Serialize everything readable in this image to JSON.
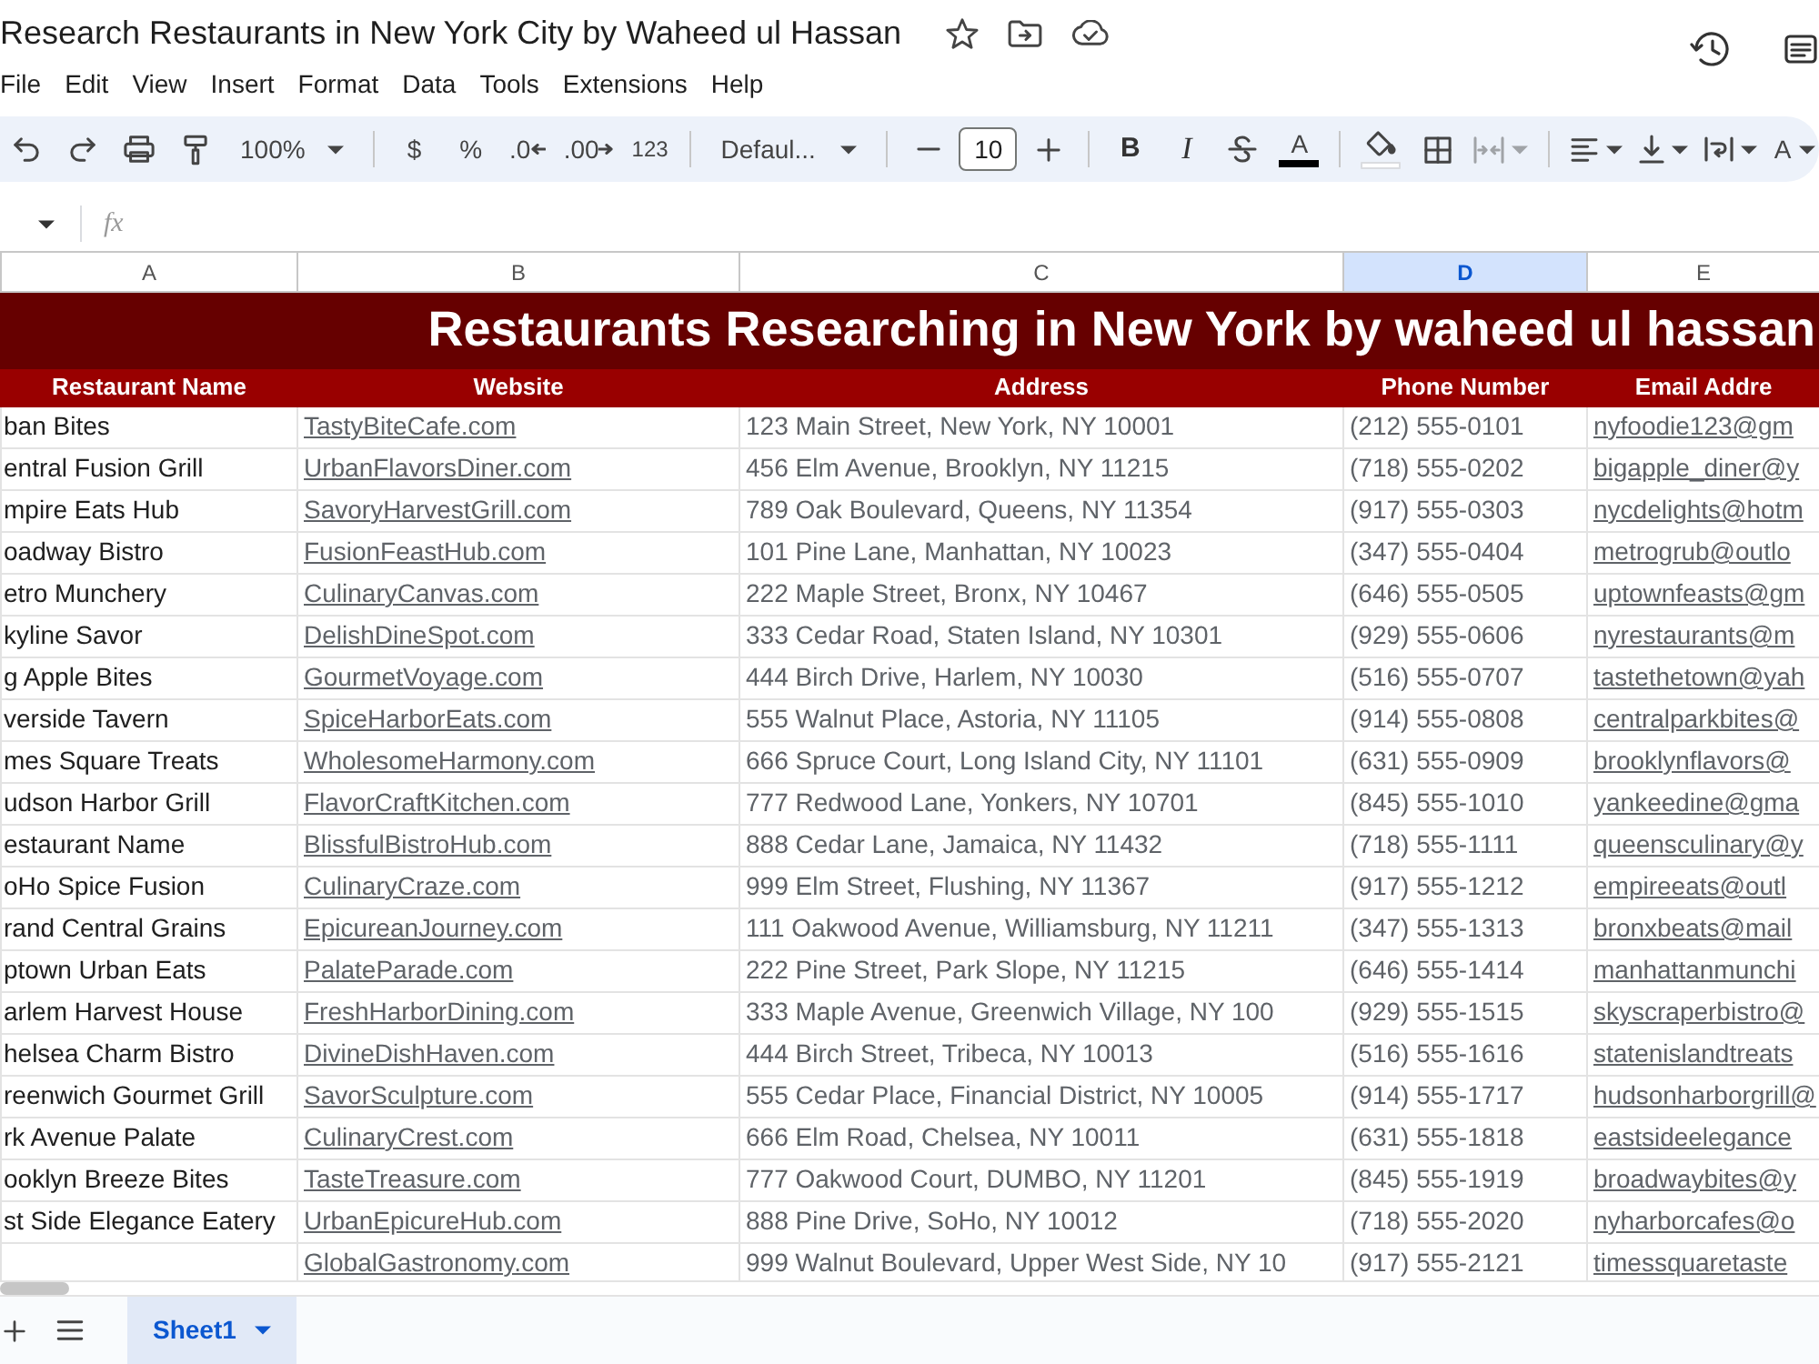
{
  "window": {
    "title": "Research Restaurants in New York City by Waheed ul Hassan"
  },
  "menu": [
    "File",
    "Edit",
    "View",
    "Insert",
    "Format",
    "Data",
    "Tools",
    "Extensions",
    "Help"
  ],
  "toolbar": {
    "zoom": "100%",
    "currency": "$",
    "percent": "%",
    "decrease_decimal": ".0",
    "increase_decimal": ".00",
    "number_format": "123",
    "font": "Defaul...",
    "font_size": "10",
    "bold": "B",
    "italic": "I",
    "text_color": "A",
    "text_rotation": "A",
    "merge_disabled": true
  },
  "formula_bar": {
    "label": "fx"
  },
  "columns": [
    {
      "letter": "A",
      "selected": false
    },
    {
      "letter": "B",
      "selected": false
    },
    {
      "letter": "C",
      "selected": false
    },
    {
      "letter": "D",
      "selected": true
    },
    {
      "letter": "E",
      "selected": false
    }
  ],
  "sheet": {
    "title": "Restaurants Researching in New York by waheed ul hassan",
    "headers": [
      "Restaurant Name",
      "Website",
      "Address",
      "Phone Number",
      "Email Addre"
    ],
    "rows": [
      {
        "name": "ban Bites",
        "website": "TastyBiteCafe.com",
        "address": "123 Main Street, New York, NY 10001",
        "phone": "(212) 555-0101",
        "email": "nyfoodie123@gm"
      },
      {
        "name": "entral Fusion Grill",
        "website": "UrbanFlavorsDiner.com",
        "address": "456 Elm Avenue, Brooklyn, NY 11215",
        "phone": "(718) 555-0202",
        "email": "bigapple_diner@y"
      },
      {
        "name": "mpire Eats Hub",
        "website": "SavoryHarvestGrill.com",
        "address": "789 Oak Boulevard, Queens, NY 11354",
        "phone": "(917) 555-0303",
        "email": "nycdelights@hotm"
      },
      {
        "name": "oadway Bistro",
        "website": "FusionFeastHub.com",
        "address": "101 Pine Lane, Manhattan, NY 10023",
        "phone": "(347) 555-0404",
        "email": "metrogrub@outlo"
      },
      {
        "name": "etro Munchery",
        "website": "CulinaryCanvas.com",
        "address": "222 Maple Street, Bronx, NY 10467",
        "phone": "(646) 555-0505",
        "email": "uptownfeasts@gm"
      },
      {
        "name": "kyline Savor",
        "website": "DelishDineSpot.com",
        "address": "333 Cedar Road, Staten Island, NY 10301",
        "phone": "(929) 555-0606",
        "email": "nyrestaurants@m"
      },
      {
        "name": "g Apple Bites",
        "website": "GourmetVoyage.com",
        "address": "444 Birch Drive, Harlem, NY 10030",
        "phone": "(516) 555-0707",
        "email": "tastethetown@yah"
      },
      {
        "name": "verside Tavern",
        "website": "SpiceHarborEats.com",
        "address": "555 Walnut Place, Astoria, NY 11105",
        "phone": "(914) 555-0808",
        "email": "centralparkbites@"
      },
      {
        "name": "mes Square Treats",
        "website": "WholesomeHarmony.com",
        "address": "666 Spruce Court, Long Island City, NY 11101",
        "phone": "(631) 555-0909",
        "email": "brooklynflavors@"
      },
      {
        "name": "udson Harbor Grill",
        "website": "FlavorCraftKitchen.com",
        "address": "777 Redwood Lane, Yonkers, NY 10701",
        "phone": "(845) 555-1010",
        "email": "yankeedine@gma"
      },
      {
        "name": "estaurant Name",
        "website": "BlissfulBistroHub.com",
        "address": "888 Cedar Lane, Jamaica, NY 11432",
        "phone": "(718) 555-1111",
        "email": "queensculinary@y"
      },
      {
        "name": "oHo Spice Fusion",
        "website": "CulinaryCraze.com",
        "address": "999 Elm Street, Flushing, NY 11367",
        "phone": "(917) 555-1212",
        "email": "empireeats@outl"
      },
      {
        "name": "rand Central Grains",
        "website": "EpicureanJourney.com",
        "address": "111 Oakwood Avenue, Williamsburg, NY 11211",
        "phone": "(347) 555-1313",
        "email": "bronxbeats@mail"
      },
      {
        "name": "ptown Urban Eats",
        "website": "PalateParade.com",
        "address": "222 Pine Street, Park Slope, NY 11215",
        "phone": "(646) 555-1414",
        "email": "manhattanmunchi"
      },
      {
        "name": "arlem Harvest House",
        "website": "FreshHarborDining.com",
        "address": "333 Maple Avenue, Greenwich Village, NY 100",
        "phone": "(929) 555-1515",
        "email": "skyscraperbistro@"
      },
      {
        "name": "helsea Charm Bistro",
        "website": "DivineDishHaven.com",
        "address": "444 Birch Street, Tribeca, NY 10013",
        "phone": "(516) 555-1616",
        "email": "statenislandtreats"
      },
      {
        "name": "reenwich Gourmet Grill",
        "website": "SavorSculpture.com",
        "address": "555 Cedar Place, Financial District, NY 10005",
        "phone": "(914) 555-1717",
        "email": "hudsonharborgrill@"
      },
      {
        "name": "rk Avenue Palate",
        "website": "CulinaryCrest.com",
        "address": "666 Elm Road, Chelsea, NY 10011",
        "phone": "(631) 555-1818",
        "email": "eastsideelegance"
      },
      {
        "name": "ooklyn Breeze Bites",
        "website": "TasteTreasure.com",
        "address": "777 Oakwood Court, DUMBO, NY 11201",
        "phone": "(845) 555-1919",
        "email": "broadwaybites@y"
      },
      {
        "name": "st Side Elegance Eatery",
        "website": "UrbanEpicureHub.com",
        "address": "888 Pine Drive, SoHo, NY 10012",
        "phone": "(718) 555-2020",
        "email": "nyharborcafes@o"
      },
      {
        "website": "GlobalGastronomy.com",
        "address": "999 Walnut Boulevard, Upper West Side, NY 10",
        "phone": "(917) 555-2121",
        "email": "timessquaretaste"
      }
    ]
  },
  "sheet_tabs": [
    {
      "label": "Sheet1",
      "selected": true
    }
  ]
}
